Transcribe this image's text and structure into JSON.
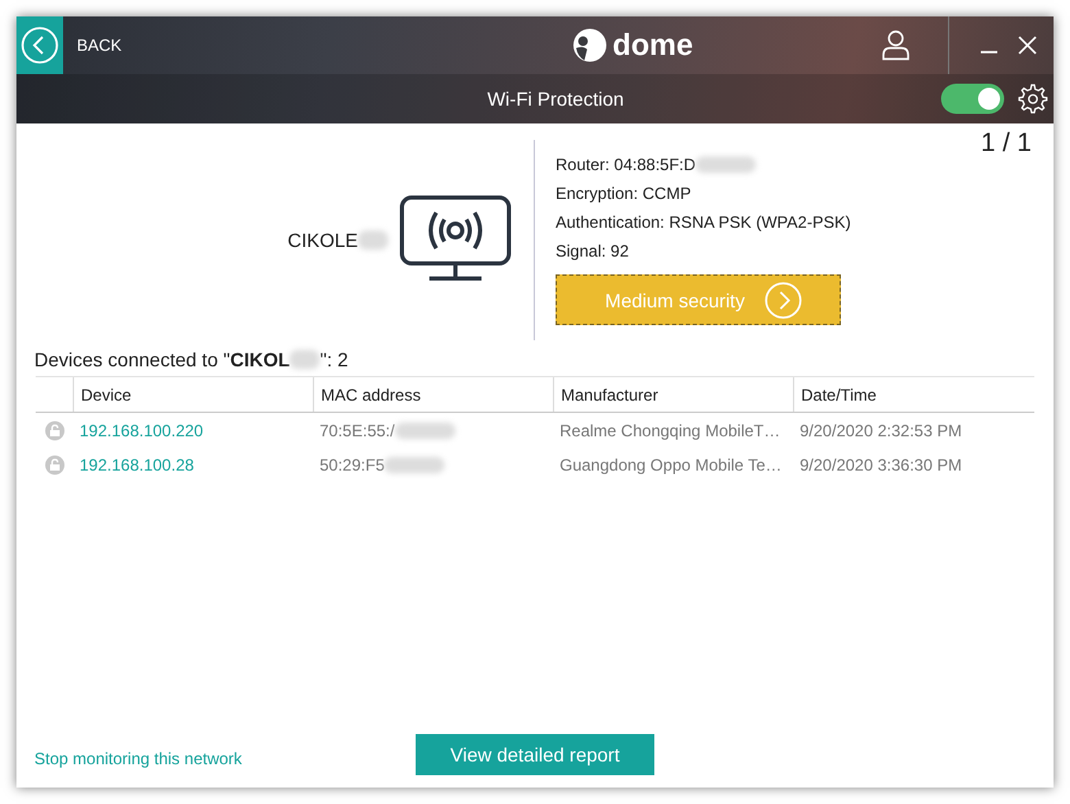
{
  "window": {
    "back_label": "BACK",
    "logo_text": "dome"
  },
  "subheader": {
    "title": "Wi-Fi Protection",
    "protection_on": true
  },
  "pager": "1 / 1",
  "network": {
    "name": "CIKOLE",
    "name_redacted": true,
    "details": [
      {
        "label": "Router:",
        "value": "04:88:5F:D",
        "redacted": true
      },
      {
        "label": "Encryption:",
        "value": "CCMP",
        "redacted": false
      },
      {
        "label": "Authentication:",
        "value": "RSNA PSK (WPA2-PSK)",
        "redacted": false
      },
      {
        "label": "Signal:",
        "value": "92",
        "redacted": false
      }
    ],
    "security": {
      "label": "Medium security"
    }
  },
  "devices": {
    "heading_prefix": "Devices connected to \"**CIKOL**",
    "heading_redacted": true,
    "heading_suffix": "\": 2",
    "columns": [
      "Device",
      "MAC address",
      "Manufacturer",
      "Date/Time"
    ],
    "rows": [
      {
        "device": "192.168.100.220",
        "mac": "70:5E:55:/",
        "mac_redacted": true,
        "manufacturer": "Realme Chongqing MobileT…",
        "datetime": "9/20/2020 2:32:53 PM"
      },
      {
        "device": "192.168.100.28",
        "mac": "50:29:F5",
        "mac_redacted": true,
        "manufacturer": "Guangdong Oppo Mobile Te…",
        "datetime": "9/20/2020 3:36:30 PM"
      }
    ]
  },
  "footer": {
    "link": "Stop monitoring this network",
    "button": "View detailed report"
  }
}
